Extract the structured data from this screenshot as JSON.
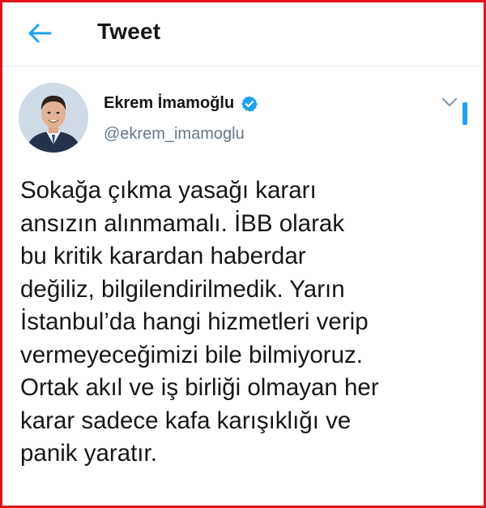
{
  "header": {
    "title": "Tweet",
    "back_icon": "arrow-left-icon",
    "accent_color": "#1da1f2"
  },
  "tweet": {
    "author": {
      "display_name": "Ekrem İmamoğlu",
      "handle": "@ekrem_imamoglu",
      "verified": true,
      "verified_icon": "verified-badge-icon"
    },
    "menu_icon": "chevron-down-icon",
    "text": "Sokağa çıkma yasağı kararı\nansızın alınmamalı. İBB olarak\nbu kritik karardan haberdar\ndeğiliz, bilgilendirilmedik. Yarın\nİstanbul’da hangi hizmetleri verip\nvermeyeceğimizi bile bilmiyoruz.\nOrtak akıl ve iş birliği olmayan her\nkarar sadece kafa karışıklığı ve\npanik yaratır."
  },
  "colors": {
    "border": "#e0141e",
    "text": "#14171a",
    "secondary_text": "#657786",
    "divider": "#e6ecf0"
  }
}
